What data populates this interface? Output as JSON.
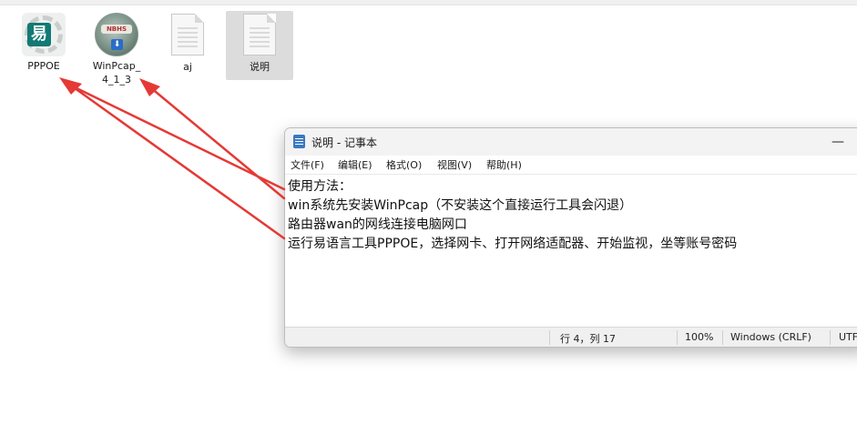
{
  "desktop": {
    "icons": [
      {
        "label": "PPPOE"
      },
      {
        "label": "WinPcap_\n4_1_3",
        "logo_text": "NBHS"
      },
      {
        "label": "aj"
      },
      {
        "label": "说明"
      }
    ]
  },
  "notepad": {
    "title": "说明 - 记事本",
    "minimize_glyph": "—",
    "menu": [
      "文件(F)",
      "编辑(E)",
      "格式(O)",
      "视图(V)",
      "帮助(H)"
    ],
    "lines": [
      "使用方法：",
      "win系统先安装WinPcap（不安装这个直接运行工具会闪退）",
      "路由器wan的网线连接电脑网口",
      "运行易语言工具PPPOE，选择网卡、打开网络适配器、开始监视，坐等账号密码"
    ],
    "status": {
      "position": "行 4，列 17",
      "zoom": "100%",
      "line_ending": "Windows (CRLF)",
      "encoding": "UTF"
    }
  },
  "colors": {
    "annotation_arrow": "#e53935",
    "pppoe_tile": "#127a74",
    "selection": "#dcdcdc"
  }
}
